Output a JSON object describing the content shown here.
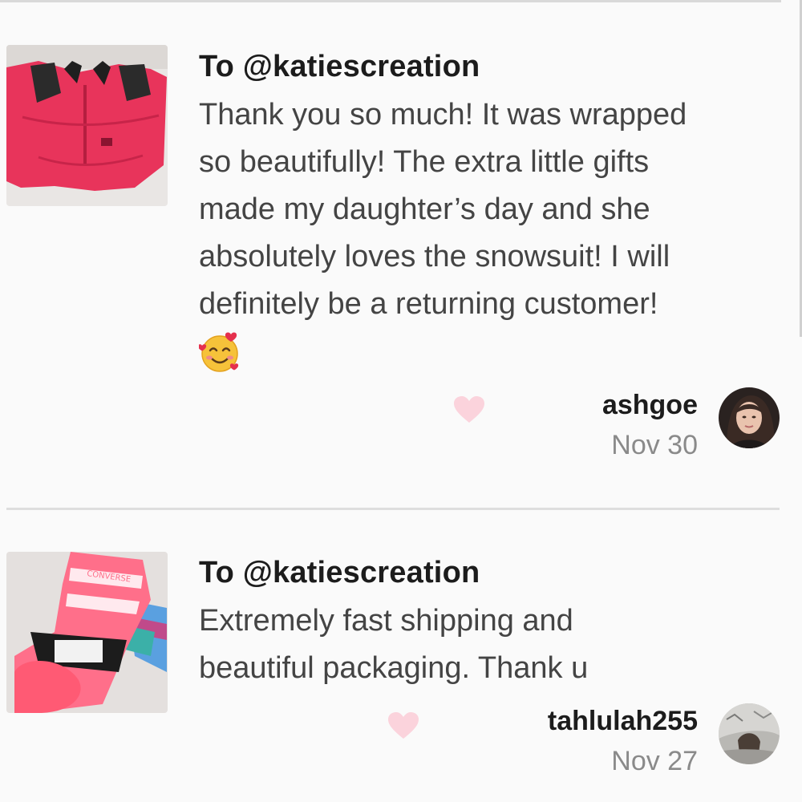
{
  "reviews": [
    {
      "recipient": "To @katiescreation",
      "message": "Thank you so much! It was wrapped\nso beautifully! The extra little gifts\nmade my daughter’s day and she\nabsolutely loves the snowsuit! I will\ndefinitely be a returning customer!",
      "emoji": "smiling-face-with-hearts",
      "username": "ashgoe",
      "date": "Nov 30",
      "product_icon": "pink-snowsuit-photo",
      "avatar_icon": "user-avatar-photo"
    },
    {
      "recipient": "To @katiescreation",
      "message": "Extremely fast shipping and\nbeautiful packaging. Thank u",
      "username": "tahlulah255",
      "date": "Nov 27",
      "product_icon": "converse-socks-photo",
      "avatar_icon": "user-avatar-photo"
    }
  ],
  "colors": {
    "heart": "#fbd3dc",
    "snowsuit": "#e8345b",
    "background": "#fafafa"
  }
}
